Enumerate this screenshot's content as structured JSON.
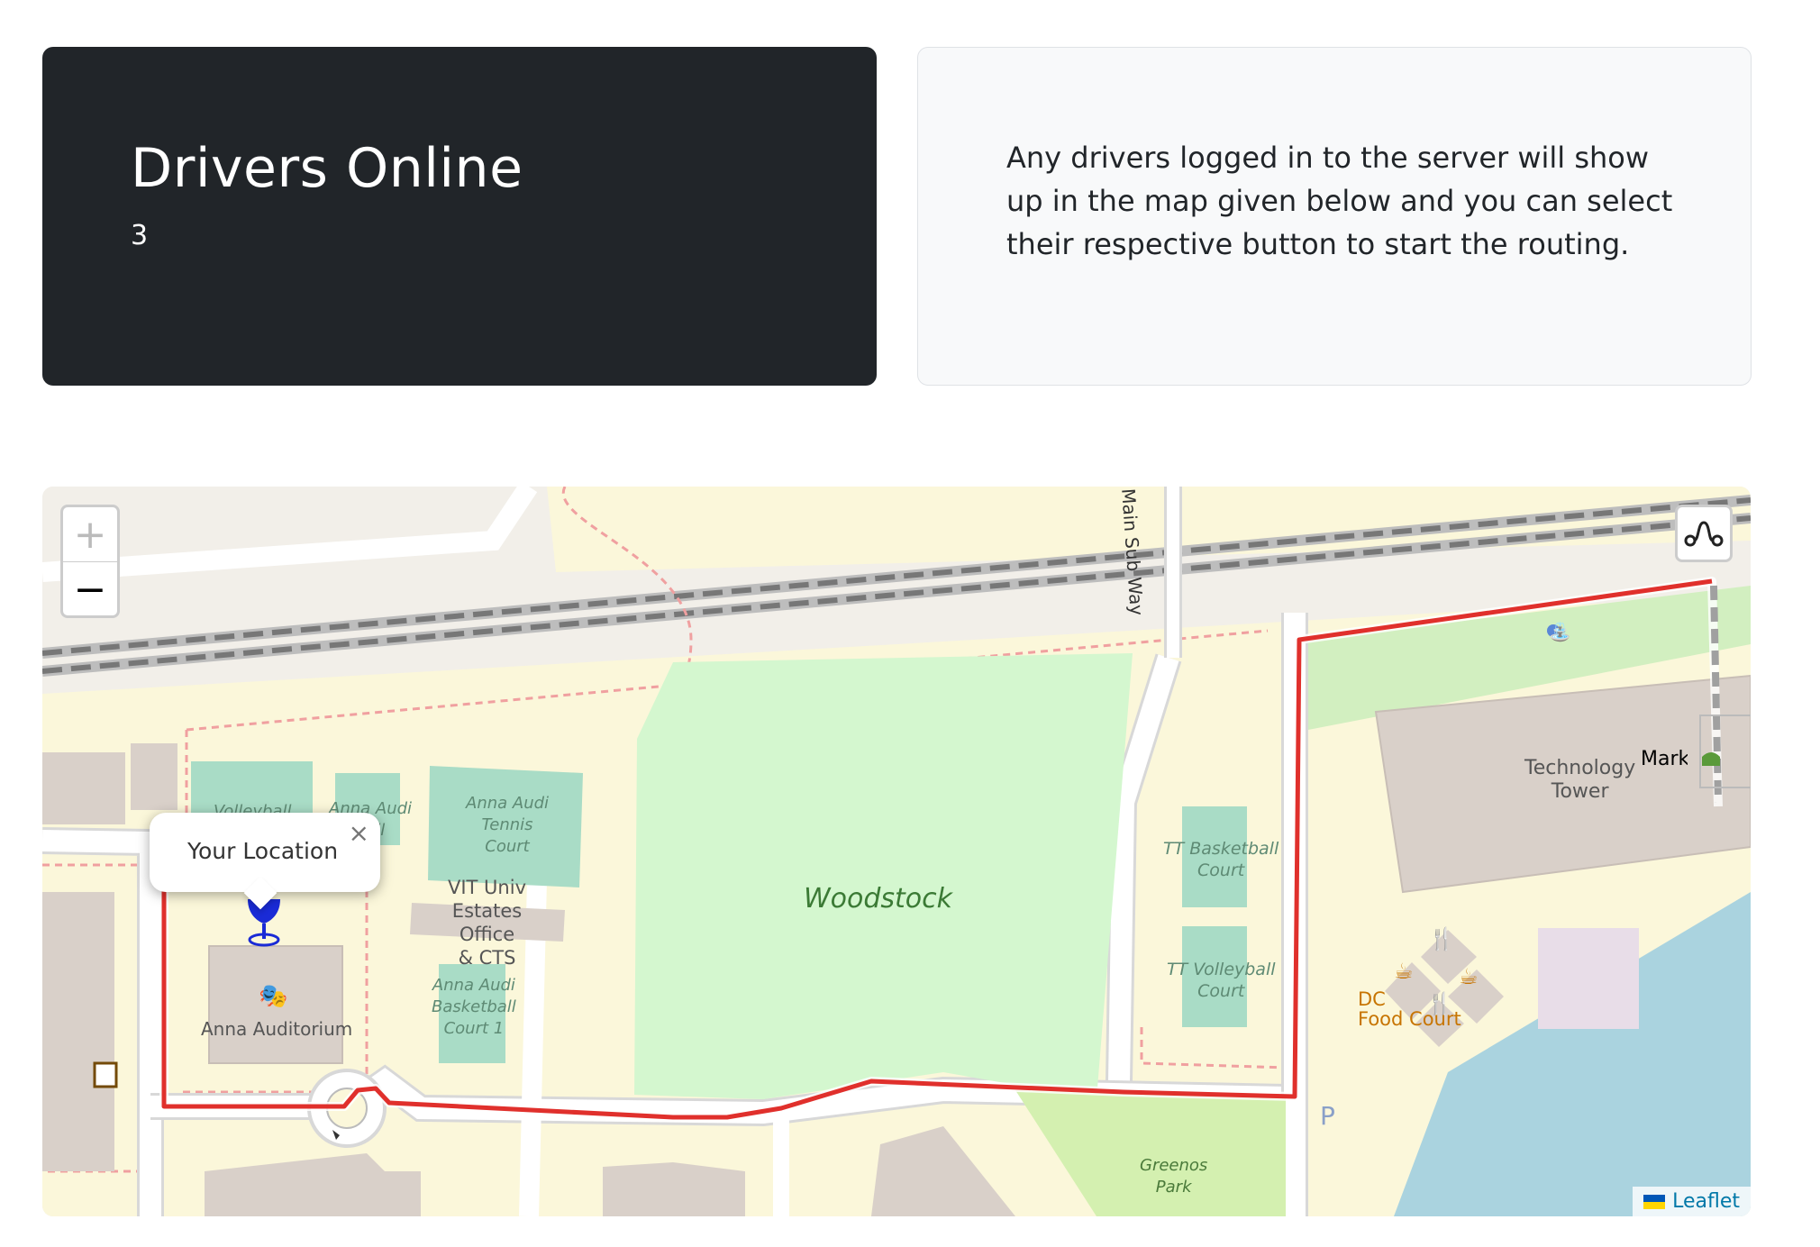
{
  "drivers_card": {
    "title": "Drivers Online",
    "count": "3"
  },
  "info_card": {
    "text": "Any drivers logged in to the server will show up in the map given below and you can select their respective button to start the routing."
  },
  "map": {
    "zoom_in": "+",
    "zoom_out": "−",
    "popup_text": "Your Location",
    "popup_close": "×",
    "attribution": "Leaflet",
    "labels": {
      "woodstock": "Woodstock",
      "main_sub_way": "Main Sub Way",
      "technology_tower_1": "Technology",
      "technology_tower_2": "Tower",
      "marker_alt": "Mark",
      "tt_basketball_1": "TT Basketball",
      "tt_basketball_2": "Court",
      "tt_volleyball_1": "TT Volleyball",
      "tt_volleyball_2": "Court",
      "dc_1": "DC",
      "dc_2": "Food Court",
      "greenos_1": "Greenos",
      "greenos_2": "Park",
      "anna_auditorium": "Anna Auditorium",
      "tennis_1": "Anna Audi",
      "tennis_2": "Tennis",
      "tennis_3": "Court",
      "vit_1": "VIT Univ",
      "vit_2": "Estates",
      "vit_3": "Office",
      "vit_4": "& CTS",
      "basket1_1": "Anna Audi",
      "basket1_2": "Basketball",
      "basket1_3": "Court 1",
      "volley_partial": "Volleyball",
      "court2_1": "Anna Audi",
      "court2_2": "ball",
      "court2_3": "t 2",
      "parking": "P"
    },
    "colors": {
      "route": "#e0302c",
      "marker": "#1a2bd6",
      "park": "#d4f7cf",
      "pitch": "#a9dcc6",
      "water": "#aad3df",
      "building": "#d9d0c9"
    }
  }
}
